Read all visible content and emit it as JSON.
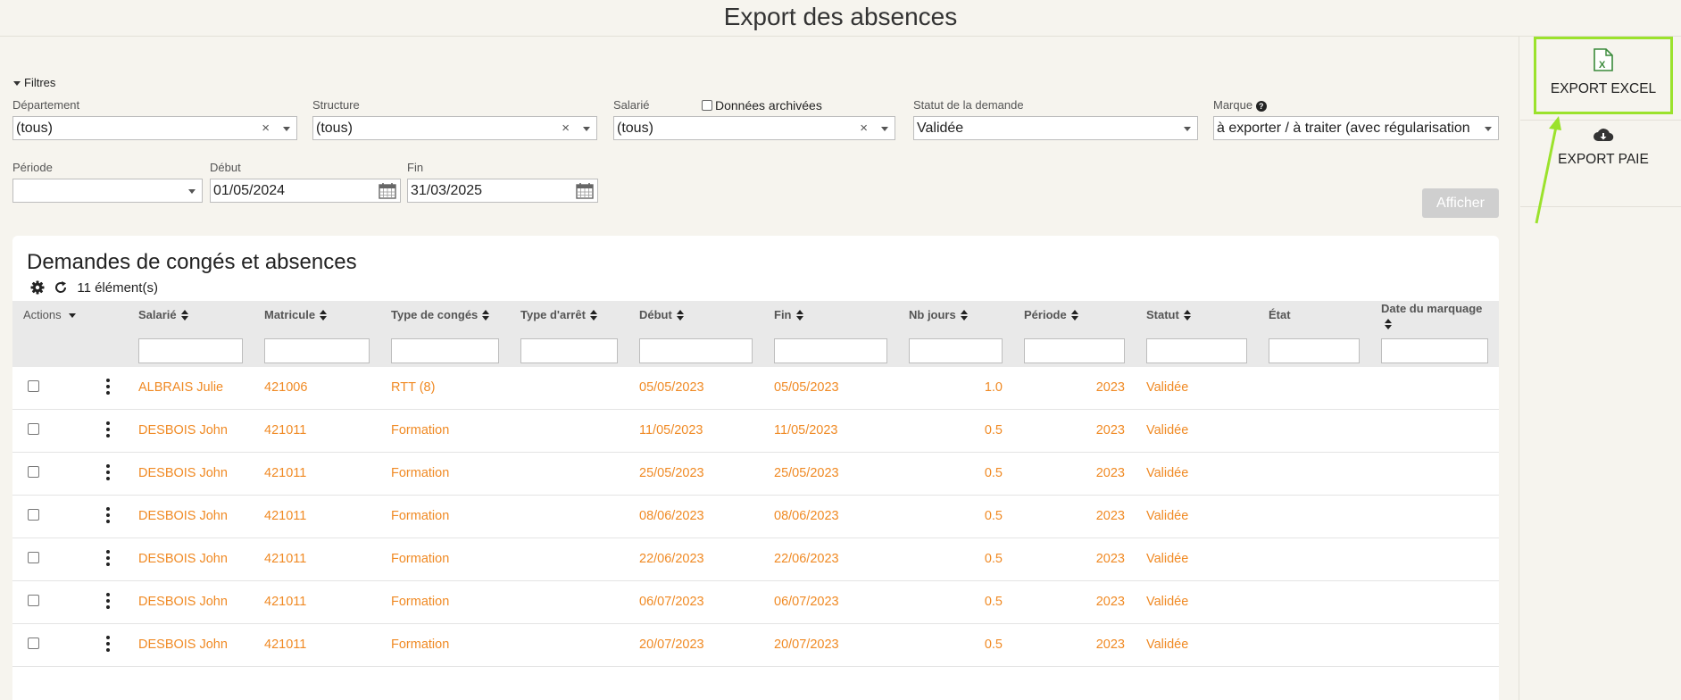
{
  "page": {
    "title": "Export des absences"
  },
  "filters": {
    "toggle_label": "Filtres",
    "departement": {
      "label": "Département",
      "value": "(tous)"
    },
    "structure": {
      "label": "Structure",
      "value": "(tous)"
    },
    "salarie": {
      "label": "Salarié",
      "value": "(tous)"
    },
    "archive": {
      "label": "Données archivées",
      "checked": false
    },
    "statut": {
      "label": "Statut de la demande",
      "value": "Validée"
    },
    "marque": {
      "label": "Marque",
      "value": "à exporter / à traiter (avec régularisation"
    },
    "periode": {
      "label": "Période",
      "value": ""
    },
    "debut": {
      "label": "Début",
      "value": "01/05/2024"
    },
    "fin": {
      "label": "Fin",
      "value": "31/03/2025"
    },
    "submit_label": "Afficher"
  },
  "panel": {
    "title": "Demandes de congés et absences",
    "count_label": "11 élément(s)",
    "columns": {
      "actions": "Actions",
      "salarie": "Salarié",
      "matricule": "Matricule",
      "type_conges": "Type de congés",
      "type_arret": "Type d'arrêt",
      "debut": "Début",
      "fin": "Fin",
      "nb_jours": "Nb jours",
      "periode": "Période",
      "statut": "Statut",
      "etat": "État",
      "date_marquage": "Date du marquage"
    },
    "rows": [
      {
        "salarie": "ALBRAIS Julie",
        "matricule": "421006",
        "type": "RTT (8)",
        "debut": "05/05/2023",
        "fin": "05/05/2023",
        "nb_jours": "1.0",
        "periode": "2023",
        "statut": "Validée"
      },
      {
        "salarie": "DESBOIS John",
        "matricule": "421011",
        "type": "Formation",
        "debut": "11/05/2023",
        "fin": "11/05/2023",
        "nb_jours": "0.5",
        "periode": "2023",
        "statut": "Validée"
      },
      {
        "salarie": "DESBOIS John",
        "matricule": "421011",
        "type": "Formation",
        "debut": "25/05/2023",
        "fin": "25/05/2023",
        "nb_jours": "0.5",
        "periode": "2023",
        "statut": "Validée"
      },
      {
        "salarie": "DESBOIS John",
        "matricule": "421011",
        "type": "Formation",
        "debut": "08/06/2023",
        "fin": "08/06/2023",
        "nb_jours": "0.5",
        "periode": "2023",
        "statut": "Validée"
      },
      {
        "salarie": "DESBOIS John",
        "matricule": "421011",
        "type": "Formation",
        "debut": "22/06/2023",
        "fin": "22/06/2023",
        "nb_jours": "0.5",
        "periode": "2023",
        "statut": "Validée"
      },
      {
        "salarie": "DESBOIS John",
        "matricule": "421011",
        "type": "Formation",
        "debut": "06/07/2023",
        "fin": "06/07/2023",
        "nb_jours": "0.5",
        "periode": "2023",
        "statut": "Validée"
      },
      {
        "salarie": "DESBOIS John",
        "matricule": "421011",
        "type": "Formation",
        "debut": "20/07/2023",
        "fin": "20/07/2023",
        "nb_jours": "0.5",
        "periode": "2023",
        "statut": "Validée"
      }
    ]
  },
  "sidebar": {
    "export_excel": {
      "label": "EXPORT EXCEL",
      "icon": "excel-file-icon"
    },
    "export_paie": {
      "label": "EXPORT PAIE",
      "icon": "cloud-download-icon"
    }
  },
  "colors": {
    "accent": "#f08a24",
    "highlight": "#9be22c",
    "background": "#f6f4ee"
  }
}
